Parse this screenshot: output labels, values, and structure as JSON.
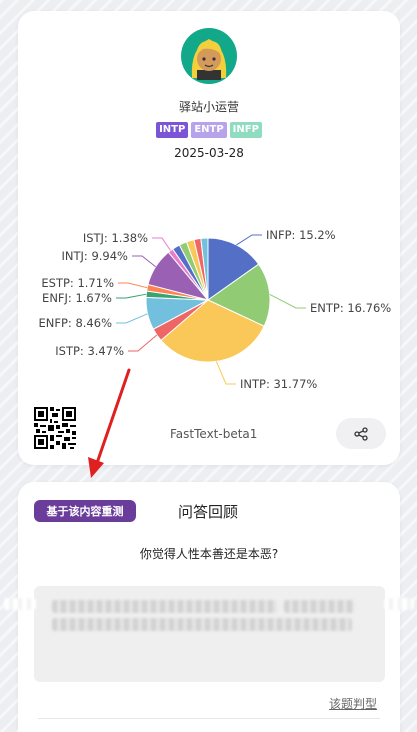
{
  "profile": {
    "username": "驿站小运营",
    "tags": [
      {
        "label": "INTP",
        "color": "#7b55d6"
      },
      {
        "label": "ENTP",
        "color": "#b7a3ec"
      },
      {
        "label": "INFP",
        "color": "#8fdcc0"
      }
    ],
    "date": "2025-03-28",
    "version": "FastText-beta1",
    "avatar_icon": "avatar-blonde-girl-icon",
    "qr_icon": "qr-code-icon",
    "share_icon": "share-icon"
  },
  "chart_data": {
    "type": "pie",
    "slices": [
      {
        "label": "INFP",
        "value": 15.2,
        "display": "INFP: 15.2%",
        "color": "#5470c6"
      },
      {
        "label": "ENTP",
        "value": 16.76,
        "display": "ENTP: 16.76%",
        "color": "#91cc75"
      },
      {
        "label": "INTP",
        "value": 31.77,
        "display": "INTP: 31.77%",
        "color": "#fac858"
      },
      {
        "label": "ISTP",
        "value": 3.47,
        "display": "ISTP: 3.47%",
        "color": "#ee6666"
      },
      {
        "label": "ENFP",
        "value": 8.46,
        "display": "ENFP: 8.46%",
        "color": "#73c0de"
      },
      {
        "label": "ENFJ",
        "value": 1.67,
        "display": "ENFJ: 1.67%",
        "color": "#3ba272"
      },
      {
        "label": "ESTP",
        "value": 1.71,
        "display": "ESTP: 1.71%",
        "color": "#fc8452"
      },
      {
        "label": "INTJ",
        "value": 9.94,
        "display": "INTJ: 9.94%",
        "color": "#9a60b4"
      },
      {
        "label": "ISTJ",
        "value": 1.38,
        "display": "ISTJ: 1.38%",
        "color": "#ea7ccc"
      },
      {
        "label": "",
        "value": 2.0,
        "display": "",
        "color": "#5470c6"
      },
      {
        "label": "",
        "value": 2.0,
        "display": "",
        "color": "#91cc75"
      },
      {
        "label": "",
        "value": 2.0,
        "display": "",
        "color": "#fac858"
      },
      {
        "label": "",
        "value": 1.8,
        "display": "",
        "color": "#ee6666"
      },
      {
        "label": "",
        "value": 1.84,
        "display": "",
        "color": "#73c0de"
      }
    ]
  },
  "review": {
    "redo_label": "基于该内容重测",
    "title": "问答回顾",
    "question": "你觉得人性本善还是本恶?",
    "judge_label": "该题判型"
  }
}
